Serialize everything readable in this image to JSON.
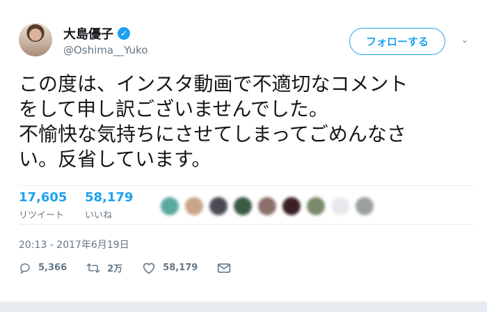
{
  "user": {
    "display_name": "大島優子",
    "verified_mark": "✓",
    "handle": "@Oshima__Yuko"
  },
  "follow_label": "フォローする",
  "chevron_glyph": "⌄",
  "tweet": {
    "lines": [
      "この度は、インスタ動画で不適切なコメント",
      "をして申し訳ございませんでした。",
      "不愉快な気持ちにさせてしまってごめんなさ",
      "い。反省しています。"
    ]
  },
  "stats": {
    "retweets": {
      "value": "17,605",
      "label": "リツイート"
    },
    "likes": {
      "value": "58,179",
      "label": "いいね"
    }
  },
  "liker_colors": [
    "#5aa9a0",
    "#c9a58a",
    "#4a4a55",
    "#3d5a45",
    "#8a6f6a",
    "#3a2025",
    "#7a8a6a",
    "#e8e8ec",
    "#9aa0a0"
  ],
  "timestamp": "20:13 - 2017年6月19日",
  "actions": {
    "reply_count": "5,366",
    "retweet_count": "2万",
    "like_count": "58,179"
  },
  "colors": {
    "accent": "#1da1f2",
    "muted": "#657786"
  }
}
